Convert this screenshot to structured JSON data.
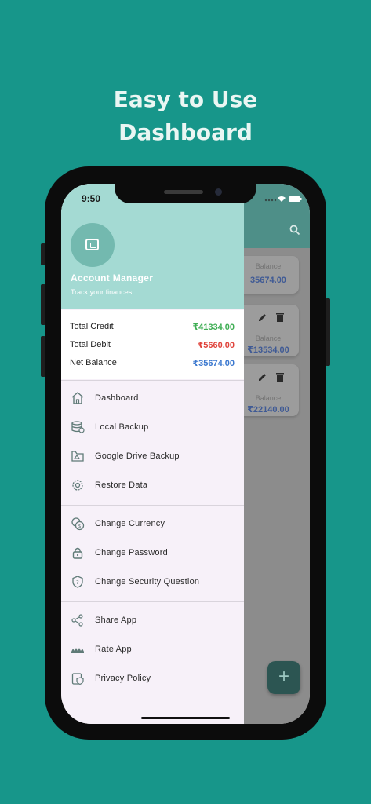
{
  "promo": {
    "line1": "Easy to Use",
    "line2": "Dashboard"
  },
  "status": {
    "time": "9:50"
  },
  "drawer": {
    "app_name": "Account Manager",
    "app_sub": "Track your finances",
    "summary": [
      {
        "label": "Total Credit",
        "value": "₹41334.00",
        "kind": "credit"
      },
      {
        "label": "Total Debit",
        "value": "₹5660.00",
        "kind": "debit"
      },
      {
        "label": "Net Balance",
        "value": "₹35674.00",
        "kind": "net"
      }
    ],
    "menu_group1": [
      {
        "label": "Dashboard",
        "icon": "home-icon"
      },
      {
        "label": "Local Backup",
        "icon": "database-icon"
      },
      {
        "label": "Google Drive Backup",
        "icon": "drive-icon"
      },
      {
        "label": "Restore Data",
        "icon": "settings-icon"
      }
    ],
    "menu_group2": [
      {
        "label": "Change Currency",
        "icon": "currency-icon"
      },
      {
        "label": "Change Password",
        "icon": "lock-icon"
      },
      {
        "label": "Change Security Question",
        "icon": "shield-icon"
      }
    ],
    "menu_group3": [
      {
        "label": "Share App",
        "icon": "share-icon"
      },
      {
        "label": "Rate App",
        "icon": "rating-icon"
      },
      {
        "label": "Privacy Policy",
        "icon": "privacy-icon"
      }
    ]
  },
  "background": {
    "balance_label": "Balance",
    "total_balance": "35674.00",
    "account1_balance": "₹13534.00",
    "account2_balance": "₹22140.00"
  },
  "colors": {
    "page_bg": "#17968a",
    "drawer_header": "#a4dad3",
    "credit": "#3fae54",
    "debit": "#e0433b",
    "net": "#3b78cf"
  }
}
